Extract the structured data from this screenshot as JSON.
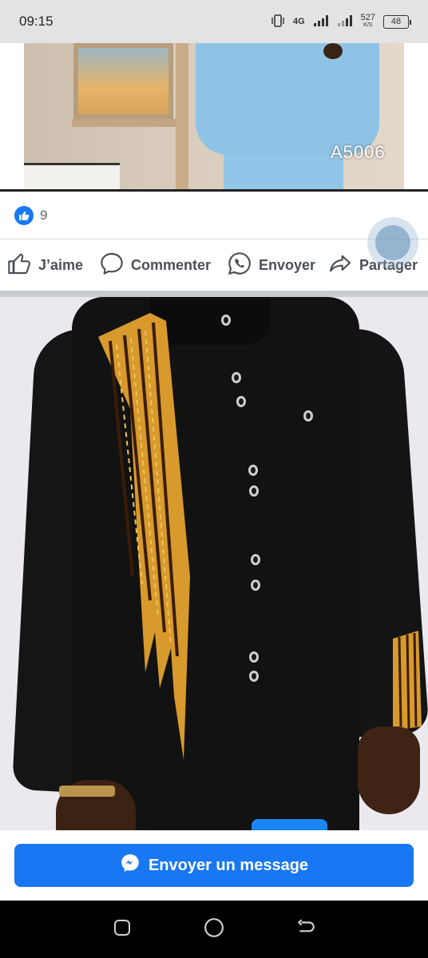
{
  "status_bar": {
    "time": "09:15",
    "network": "4G",
    "speed_value": "527",
    "speed_unit": "K/S",
    "battery": "48"
  },
  "post_photo": {
    "code_label": "A5006"
  },
  "reactions": {
    "count": "9"
  },
  "actions": {
    "like_label": "J’aime",
    "comment_label": "Commenter",
    "send_label": "Envoyer",
    "share_label": "Partager"
  },
  "cta": {
    "label": "Envoyer un message"
  },
  "colors": {
    "accent": "#1877f2",
    "status_bar_bg": "#e3e3e5",
    "nav_bar_bg": "#000000"
  },
  "icons": {
    "like": "thumbs-up-icon",
    "comment": "speech-bubble-icon",
    "send": "whatsapp-icon",
    "share": "share-arrow-icon",
    "messenger": "messenger-icon",
    "nav_recents": "square-icon",
    "nav_home": "circle-icon",
    "nav_back": "back-arrow-icon"
  }
}
